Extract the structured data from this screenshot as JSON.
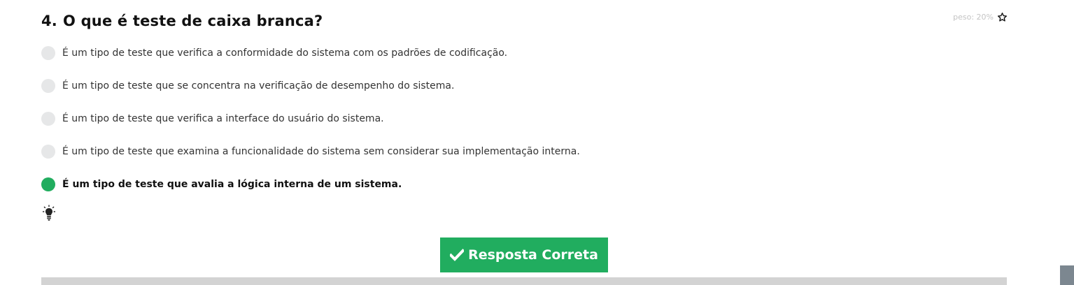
{
  "question": {
    "number": "4.",
    "text": "O que é teste de caixa branca?",
    "weight": "peso: 20%"
  },
  "options": [
    {
      "label": "É um tipo de teste que verifica a conformidade do sistema com os padrões de codificação.",
      "selected": false
    },
    {
      "label": "É um tipo de teste que se concentra na verificação de desempenho do sistema.",
      "selected": false
    },
    {
      "label": "É um tipo de teste que verifica a interface do usuário do sistema.",
      "selected": false
    },
    {
      "label": "É um tipo de teste que examina a funcionalidade do sistema sem considerar sua implementação interna.",
      "selected": false
    },
    {
      "label": "É um tipo de teste que avalia a lógica interna de um sistema.",
      "selected": true
    }
  ],
  "answer_button": {
    "label": "Resposta Correta",
    "icon": "check-icon"
  },
  "icons": {
    "weight": "star-outline-icon",
    "hint": "lightbulb-icon"
  },
  "colors": {
    "correct_green": "#21ad5f",
    "radio_unselected": "#e6e7e8",
    "progress_track": "#d3d3d3",
    "weight_text": "#c4c4c4"
  }
}
